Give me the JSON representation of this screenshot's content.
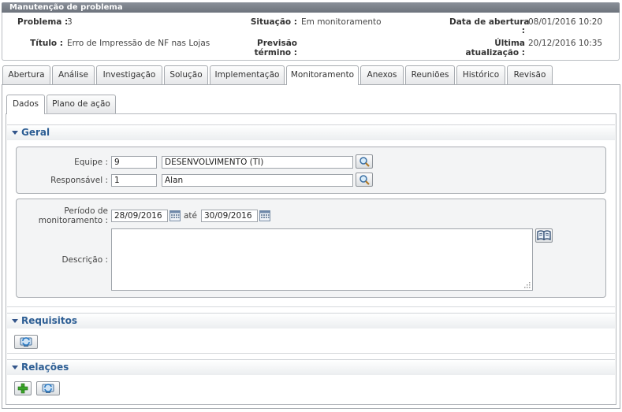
{
  "window_title": "Manutenção de problema",
  "header": {
    "problema_label": "Problema :",
    "problema_value": "3",
    "situacao_label": "Situação :",
    "situacao_value": "Em monitoramento",
    "data_abertura_label": "Data de abertura",
    "data_abertura_colon": ":",
    "data_abertura_value": "08/01/2016 10:20",
    "titulo_label": "Título :",
    "titulo_value": "Erro de Impressão de NF nas Lojas",
    "previsao_label_1": "Previsão",
    "previsao_label_2": "término :",
    "ultima_label_1": "Última",
    "ultima_label_2": "atualização :",
    "ultima_value": "20/12/2016 10:35"
  },
  "tabs": [
    "Abertura",
    "Análise",
    "Investigação",
    "Solução",
    "Implementação",
    "Monitoramento",
    "Anexos",
    "Reuniões",
    "Histórico",
    "Revisão"
  ],
  "active_tab": "Monitoramento",
  "subtabs": [
    "Dados",
    "Plano de ação"
  ],
  "active_subtab": "Dados",
  "geral": {
    "title": "Geral",
    "equipe_label": "Equipe :",
    "equipe_code": "9",
    "equipe_name": "DESENVOLVIMENTO (TI)",
    "responsavel_label": "Responsável :",
    "responsavel_code": "1",
    "responsavel_name": "Alan",
    "periodo_label_1": "Período de",
    "periodo_label_2": "monitoramento :",
    "periodo_inicio": "28/09/2016",
    "ate_label": "até",
    "periodo_fim": "30/09/2016",
    "descricao_label": "Descrição :",
    "descricao_value": ""
  },
  "requisitos": {
    "title": "Requisitos"
  },
  "relacoes": {
    "title": "Relações"
  },
  "icons": {
    "search": "magnifier-icon",
    "calendar": "calendar-icon",
    "book": "book-icon",
    "refresh": "refresh-icon",
    "add": "plus-icon"
  },
  "colors": {
    "section_title": "#2d5e94",
    "titlebar": "#7a808a",
    "add_green": "#3aa52a"
  }
}
